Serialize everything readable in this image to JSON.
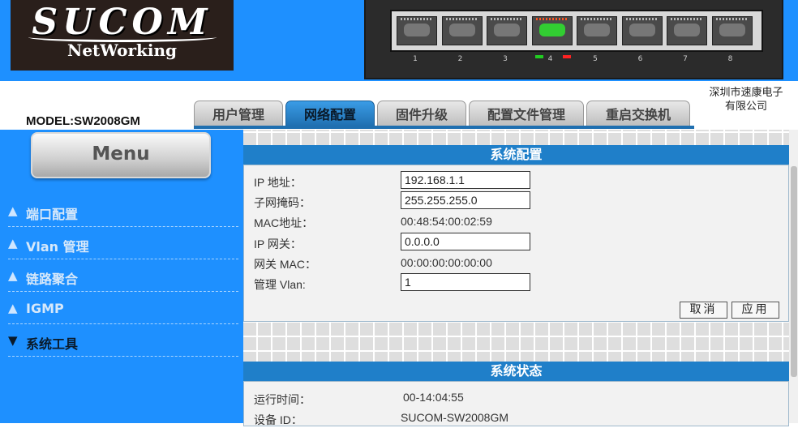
{
  "header": {
    "logo_main": "SUCOM",
    "logo_sub": "NetWorking",
    "model": "MODEL:SW2008GM",
    "company": "深圳市速康电子有限公司",
    "ports": [
      "1",
      "2",
      "3",
      "4",
      "5",
      "6",
      "7",
      "8"
    ],
    "active_port": 4,
    "colors": {
      "header_blue": "#1e90ff",
      "port_link": "#32cd32",
      "led_green": "#22cc22",
      "led_red": "#ff2222"
    }
  },
  "tabs": [
    {
      "label": "用户管理",
      "active": false
    },
    {
      "label": "网络配置",
      "active": true
    },
    {
      "label": "固件升级",
      "active": false
    },
    {
      "label": "配置文件管理",
      "active": false
    },
    {
      "label": "重启交换机",
      "active": false
    }
  ],
  "sidebar": {
    "menu_label": "Menu",
    "items": [
      {
        "label": "端口配置",
        "arrow": "▲"
      },
      {
        "label": "Vlan 管理",
        "arrow": "▲"
      },
      {
        "label": "链路聚合",
        "arrow": "▲"
      },
      {
        "label": "IGMP",
        "arrow": "▲"
      },
      {
        "label": "系统工具",
        "arrow": "▼"
      }
    ]
  },
  "system_config": {
    "title": "系统配置",
    "ip_label": "IP 地址：",
    "ip_value": "192.168.1.1",
    "mask_label": "子网掩码：",
    "mask_value": "255.255.255.0",
    "mac_label": "MAC地址：",
    "mac_value": "00:48:54:00:02:59",
    "gateway_label": "IP 网关：",
    "gateway_value": "0.0.0.0",
    "gateway_mac_label": "网关 MAC：",
    "gateway_mac_value": "00:00:00:00:00:00",
    "vlan_label": "管理 Vlan:",
    "vlan_value": "1",
    "cancel_label": "取消",
    "apply_label": "应用"
  },
  "system_status": {
    "title": "系统状态",
    "uptime_label": "运行时间：",
    "uptime_value": "00-14:04:55",
    "device_id_label": "设备 ID：",
    "device_id_value": "SUCOM-SW2008GM"
  }
}
